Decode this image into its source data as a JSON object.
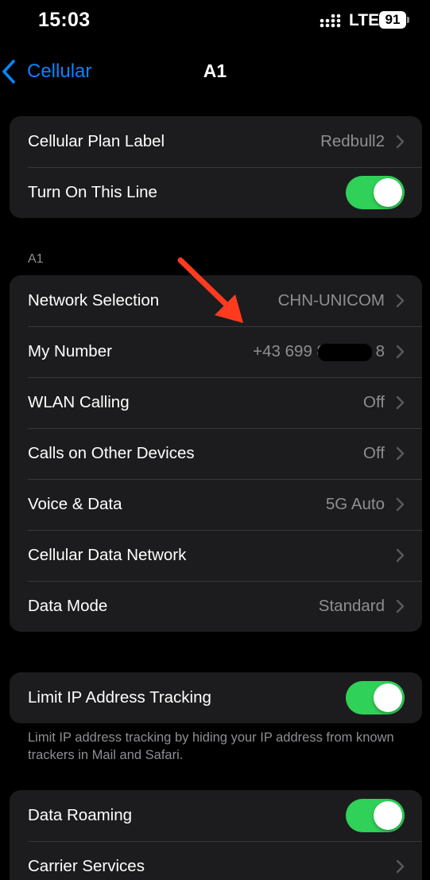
{
  "status_bar": {
    "time": "15:03",
    "network_type": "LTE",
    "battery_level": "91"
  },
  "nav": {
    "back_label": "Cellular",
    "title": "A1"
  },
  "plan_group": {
    "plan_label": {
      "label": "Cellular Plan Label",
      "value": "Redbull2"
    },
    "turn_on_line": {
      "label": "Turn On This Line",
      "toggle_on": true
    }
  },
  "section_header": "A1",
  "settings": [
    {
      "label": "Network Selection",
      "value": "CHN-UNICOM"
    },
    {
      "label": "My Number",
      "value": "+43 699 8           8"
    },
    {
      "label": "WLAN Calling",
      "value": "Off"
    },
    {
      "label": "Calls on Other Devices",
      "value": "Off"
    },
    {
      "label": "Voice & Data",
      "value": "5G Auto"
    },
    {
      "label": "Cellular Data Network",
      "value": ""
    },
    {
      "label": "Data Mode",
      "value": "Standard"
    }
  ],
  "privacy_group": {
    "limit_ip": {
      "label": "Limit IP Address Tracking",
      "toggle_on": true
    },
    "footnote": "Limit IP address tracking by hiding your IP address from known trackers in Mail and Safari."
  },
  "roaming_group": {
    "data_roaming": {
      "label": "Data Roaming",
      "toggle_on": true
    },
    "carrier_services": {
      "label": "Carrier Services",
      "value": ""
    }
  },
  "colors": {
    "accent": "#0a84ff",
    "toggle_on": "#30d158",
    "group_bg": "#1c1c1e",
    "secondary_text": "#8e8e93",
    "annotation_arrow": "#ff3b1f"
  }
}
